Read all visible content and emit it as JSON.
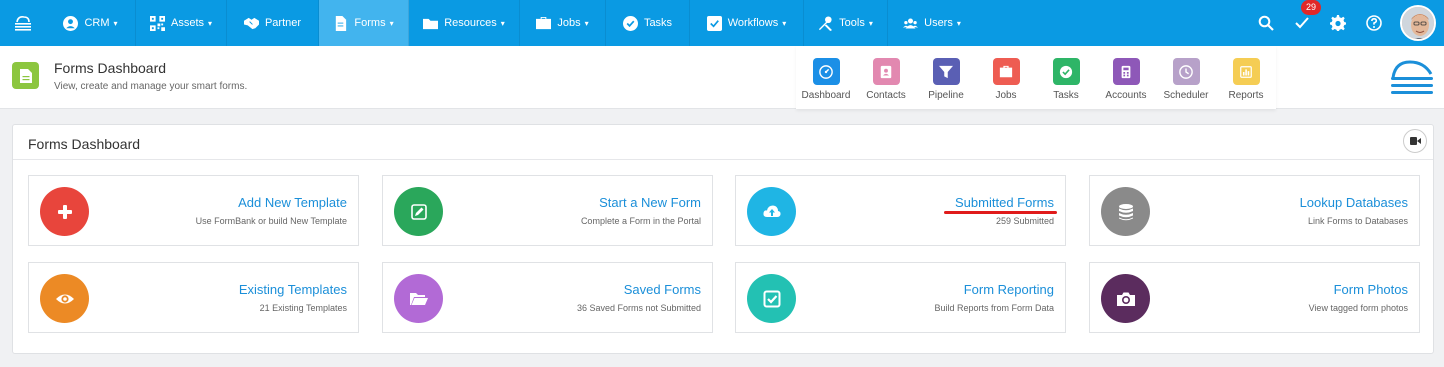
{
  "nav": {
    "items": [
      {
        "label": "CRM",
        "icon": "person-circle-icon",
        "caret": "▾"
      },
      {
        "label": "Assets",
        "icon": "qr-code-icon",
        "caret": "▾"
      },
      {
        "label": "Partner",
        "icon": "handshake-icon",
        "caret": ""
      },
      {
        "label": "Forms",
        "icon": "document-icon",
        "caret": "▾"
      },
      {
        "label": "Resources",
        "icon": "folder-icon",
        "caret": "▾"
      },
      {
        "label": "Jobs",
        "icon": "briefcase-icon",
        "caret": "▾"
      },
      {
        "label": "Tasks",
        "icon": "check-circle-icon",
        "caret": ""
      },
      {
        "label": "Workflows",
        "icon": "checkbox-icon",
        "caret": "▾"
      },
      {
        "label": "Tools",
        "icon": "tools-icon",
        "caret": "▾"
      },
      {
        "label": "Users",
        "icon": "users-icon",
        "caret": "▾"
      }
    ],
    "active": "Forms",
    "notification_count": "29",
    "color": "#0a9ae3",
    "active_color": "#42b4ee"
  },
  "header": {
    "title": "Forms Dashboard",
    "subtitle": "View, create and manage your smart forms."
  },
  "quick_links": [
    {
      "label": "Dashboard",
      "color": "#1b8fe6",
      "icon": "dashboard-icon"
    },
    {
      "label": "Contacts",
      "color": "#e288b0",
      "icon": "contacts-icon"
    },
    {
      "label": "Pipeline",
      "color": "#5a5fb4",
      "icon": "funnel-icon"
    },
    {
      "label": "Jobs",
      "color": "#ee5c52",
      "icon": "briefcase-icon"
    },
    {
      "label": "Tasks",
      "color": "#2eb567",
      "icon": "check-circle-icon"
    },
    {
      "label": "Accounts",
      "color": "#8e58b8",
      "icon": "calculator-icon"
    },
    {
      "label": "Scheduler",
      "color": "#b7a1c9",
      "icon": "clock-icon"
    },
    {
      "label": "Reports",
      "color": "#f5cd54",
      "icon": "bar-chart-icon"
    }
  ],
  "panel": {
    "title": "Forms Dashboard"
  },
  "cards": [
    {
      "title": "Add New Template",
      "subtitle": "Use FormBank or build New Template",
      "color": "#e8453c",
      "icon": "plus-icon"
    },
    {
      "title": "Start a New Form",
      "subtitle": "Complete a Form in the Portal",
      "color": "#2aa75b",
      "icon": "pencil-icon"
    },
    {
      "title": "Submitted Forms",
      "subtitle": "259 Submitted",
      "color": "#1fb5e4",
      "icon": "cloud-upload-icon"
    },
    {
      "title": "Lookup Databases",
      "subtitle": "Link Forms to Databases",
      "color": "#8a8a8a",
      "icon": "database-icon"
    },
    {
      "title": "Existing Templates",
      "subtitle": "21 Existing Templates",
      "color": "#ec8a25",
      "icon": "eye-icon"
    },
    {
      "title": "Saved Forms",
      "subtitle": "36 Saved Forms not Submitted",
      "color": "#b26ad6",
      "icon": "folder-open-icon"
    },
    {
      "title": "Form Reporting",
      "subtitle": "Build Reports from Form Data",
      "color": "#23c1b3",
      "icon": "check-square-icon"
    },
    {
      "title": "Form Photos",
      "subtitle": "View tagged form photos",
      "color": "#5b2c5e",
      "icon": "camera-icon"
    }
  ]
}
